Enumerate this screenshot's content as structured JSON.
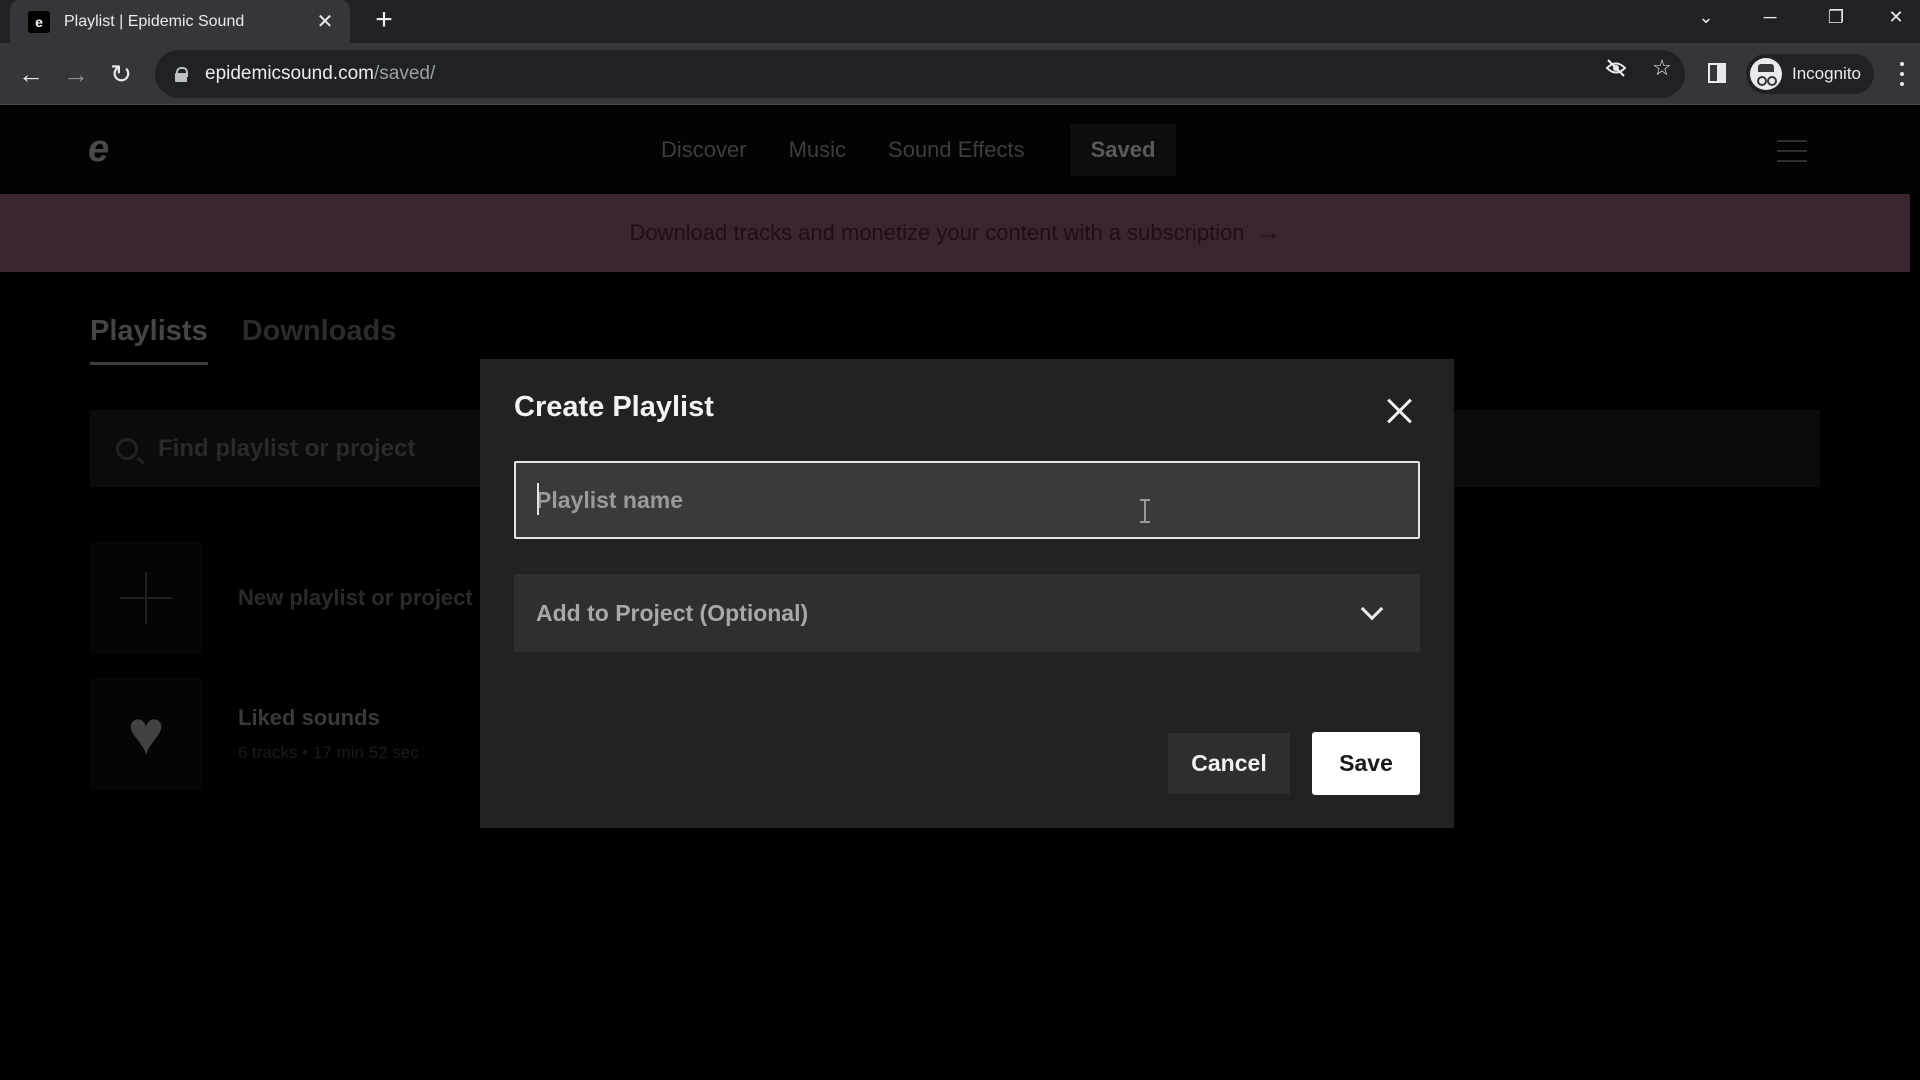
{
  "browser": {
    "tab": {
      "favicon": "epidemic-sound-logo",
      "title": "Playlist | Epidemic Sound",
      "close": "✕"
    },
    "new_tab": "+",
    "window_controls": {
      "tab_search": "⌄",
      "minimize": "─",
      "restore": "❐",
      "close": "✕"
    },
    "nav": {
      "back": "←",
      "forward": "→",
      "reload": "↻"
    },
    "url": {
      "host": "epidemicsound.com",
      "path": "/saved/"
    },
    "omnibox_icons": {
      "tracking": "eye-slash-icon",
      "bookmark": "☆"
    },
    "profile": {
      "label": "Incognito"
    }
  },
  "site": {
    "logo": "e",
    "nav": [
      {
        "label": "Discover",
        "active": false
      },
      {
        "label": "Music",
        "active": false
      },
      {
        "label": "Sound Effects",
        "active": false
      },
      {
        "label": "Saved",
        "active": true
      }
    ],
    "banner": {
      "text": "Download tracks and monetize your content with a subscription",
      "arrow": "→"
    },
    "tabs": [
      {
        "label": "Playlists",
        "active": true
      },
      {
        "label": "Downloads",
        "active": false
      }
    ],
    "search": {
      "placeholder": "Find playlist or project"
    },
    "items": [
      {
        "title": "New playlist or project",
        "subtitle": ""
      },
      {
        "title": "Liked sounds",
        "subtitle": "6 tracks • 17 min 52 sec"
      }
    ],
    "heart": "♥"
  },
  "modal": {
    "title": "Create Playlist",
    "name_input": {
      "value": "",
      "placeholder": "Playlist name"
    },
    "project_select": {
      "selected": "Add to Project (Optional)"
    },
    "cancel_label": "Cancel",
    "save_label": "Save"
  },
  "colors": {
    "banner_bg": "#3a2430",
    "modal_bg": "#222222",
    "save_bg": "#ffffff"
  }
}
